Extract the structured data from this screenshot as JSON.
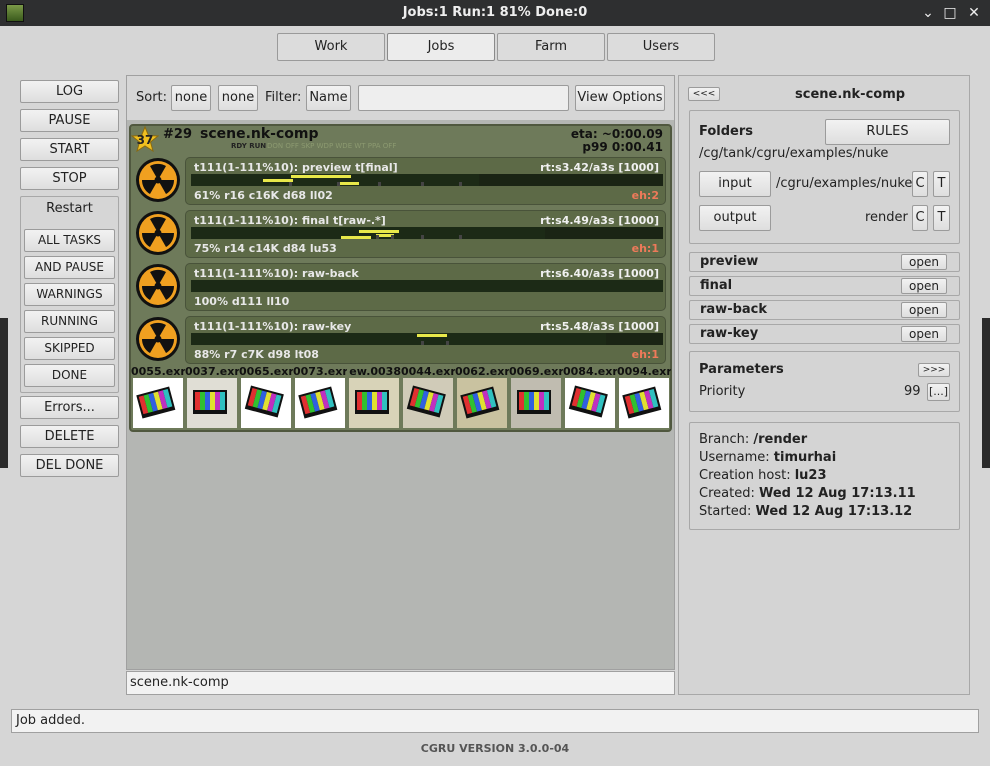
{
  "window": {
    "title": "Jobs:1 Run:1 81% Done:0"
  },
  "tabs": [
    {
      "label": "Work"
    },
    {
      "label": "Jobs"
    },
    {
      "label": "Farm"
    },
    {
      "label": "Users"
    }
  ],
  "left_buttons": {
    "log": "LOG",
    "pause": "PAUSE",
    "start": "START",
    "stop": "STOP",
    "restart": "Restart",
    "all_tasks": "ALL TASKS",
    "and_pause": "AND PAUSE",
    "warnings": "WARNINGS",
    "running": "RUNNING",
    "skipped": "SKIPPED",
    "done": "DONE",
    "errors": "Errors...",
    "delete": "DELETE",
    "del_done": "DEL DONE"
  },
  "sortbar": {
    "sort_label": "Sort:",
    "sort1": "none",
    "sort2": "none",
    "filter_label": "Filter:",
    "filter_by": "Name",
    "filter_value": "",
    "view_options": "View Options"
  },
  "job": {
    "star_number": "37",
    "id": "#29",
    "name": "scene.nk-comp",
    "state": "RDY RUN",
    "state_dim": "DON OFF SKP WDP WDE  WT  PPA OFF",
    "eta": "eta: ~0:00.09",
    "priority": "p99 0:00.41",
    "tasks": [
      {
        "name": "t111(1-111%10): preview t[final]",
        "rt": "rt:s3.42/a3s [1000]",
        "info": "61% r16 c16K d68 ll02",
        "eh": "eh:2",
        "progress": 0.61
      },
      {
        "name": "t111(1-111%10): final t[raw-.*]",
        "rt": "rt:s4.49/a3s [1000]",
        "info": "75% r14 c14K d84 lu53",
        "eh": "eh:1",
        "progress": 0.75
      },
      {
        "name": "t111(1-111%10): raw-back",
        "rt": "rt:s6.40/a3s [1000]",
        "info": "100% d111 ll10",
        "eh": "",
        "progress": 1.0
      },
      {
        "name": "t111(1-111%10): raw-key",
        "rt": "rt:s5.48/a3s [1000]",
        "info": "88% r7 c7K d98 lt08",
        "eh": "eh:1",
        "progress": 0.88
      }
    ],
    "thumbnails": [
      "0055.exr",
      "0037.exr",
      "0065.exr",
      "0073.exr",
      "ew.0038",
      "0044.exr",
      "0062.exr",
      "0069.exr",
      "0084.exr",
      "0094.exr"
    ]
  },
  "bottom_name": "scene.nk-comp",
  "right": {
    "back_button": "<<<",
    "job_name": "scene.nk-comp",
    "folders_label": "Folders",
    "rules_button": "RULES",
    "folder_path": "/cg/tank/cgru/examples/nuke",
    "input_button": "input",
    "input_path": "/cgru/examples/nuke",
    "output_button": "output",
    "output_path": "render",
    "c_label": "C",
    "t_label": "T",
    "blocks": [
      {
        "name": "preview",
        "action": "open"
      },
      {
        "name": "final",
        "action": "open"
      },
      {
        "name": "raw-back",
        "action": "open"
      },
      {
        "name": "raw-key",
        "action": "open"
      }
    ],
    "parameters_label": "Parameters",
    "params_expand": ">>>",
    "priority_label": "Priority",
    "priority_value": "99",
    "priority_edit": "[...]",
    "info": {
      "branch_label": "Branch:",
      "branch": "/render",
      "username_label": "Username:",
      "username": "timurhai",
      "host_label": "Creation host:",
      "host": "lu23",
      "created_label": "Created:",
      "created": "Wed 12 Aug 17:13.11",
      "started_label": "Started:",
      "started": "Wed 12 Aug 17:13.12"
    }
  },
  "status": "Job added.",
  "version": "CGRU VERSION 3.0.0-04",
  "colors": {
    "job_card": "#6e7a5a",
    "task_row": "#5d6a47",
    "progress_bar": "#e8e84a",
    "error_text": "#ee7a5a",
    "nuke_icon": "#f0a020"
  }
}
